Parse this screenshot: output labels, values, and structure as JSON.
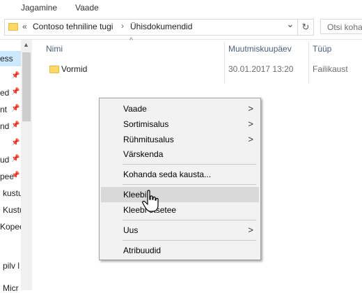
{
  "ribbon": {
    "tabs": [
      "Jagamine",
      "Vaade"
    ]
  },
  "address": {
    "back_glyph": "«",
    "segments": [
      "Contoso tehniline tugi",
      "Ühisdokumendid"
    ],
    "separator": "›",
    "dropdown_glyph": "⌄",
    "refresh_glyph": "↻",
    "search_placeholder": "Otsi koha"
  },
  "nav": {
    "items": [
      "ess",
      "ed",
      "nt",
      "nd",
      "ud",
      "pee",
      "kustu",
      "Kustu",
      "Kopee",
      "pilv l",
      "Micr"
    ]
  },
  "columns": {
    "name": "Nimi",
    "modified": "Muutmiskuupäev",
    "type": "Tüüp",
    "sort_glyph": "^"
  },
  "files": [
    {
      "name": "Vormid",
      "modified": "30.01.2017 13:20",
      "type": "Failikaust"
    }
  ],
  "menu": {
    "view": "Vaade",
    "sort": "Sortimisalus",
    "group": "Rühmitusalus",
    "refresh": "Värskenda",
    "customize": "Kohanda seda kausta...",
    "paste": "Kleebi",
    "paste_shortcut": "Kleebi otsetee",
    "new": "Uus",
    "properties": "Atribuudid"
  },
  "colors": {
    "folder": "#ffd866",
    "selection": "#cce8ff",
    "menu_bg": "#f2f2f2",
    "menu_hover": "#d9d9d9"
  }
}
